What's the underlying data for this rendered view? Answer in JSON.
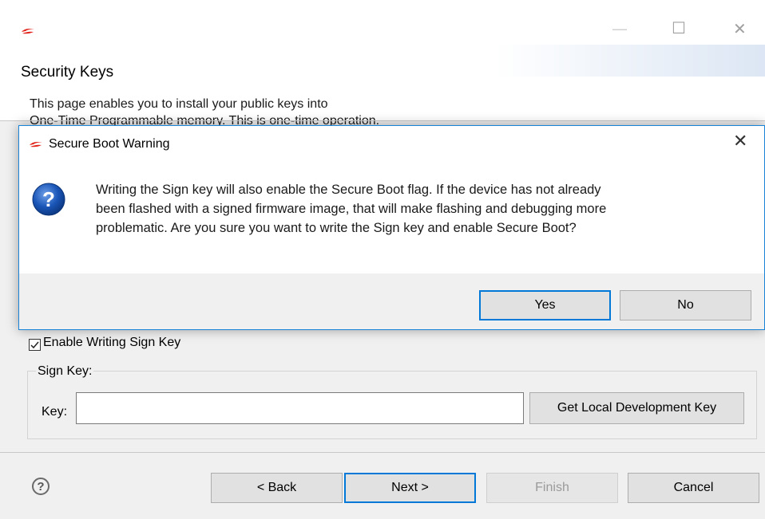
{
  "wizard": {
    "window_controls": {
      "minimize": "—",
      "maximize": "☐",
      "close": "✕"
    },
    "title": "Security Keys",
    "description_line1": "This page enables you to install your public keys into",
    "description_line2": "One-Time Programmable memory. This is one-time operation.",
    "enable_checkbox": {
      "label": "Enable Writing Sign Key",
      "checked": true
    },
    "sign_key_group": {
      "legend": "Sign Key:",
      "key_label": "Key:",
      "key_value": "",
      "get_key_button": "Get Local Development Key"
    },
    "buttons": {
      "back": "< Back",
      "next": "Next >",
      "finish": "Finish",
      "cancel": "Cancel"
    },
    "help_icon": "question-circle-icon"
  },
  "dialog": {
    "title": "Secure Boot Warning",
    "close": "✕",
    "icon": "question-icon",
    "message_line1": "Writing the Sign key will also enable the Secure Boot flag. If the device has not already",
    "message_line2": "been flashed with a signed firmware image, that will make flashing and debugging more",
    "message_line3": "problematic. Are you sure you want to write the Sign key and enable Secure Boot?",
    "yes": "Yes",
    "no": "No"
  },
  "colors": {
    "accent": "#0078d7",
    "logo_red": "#e2231a",
    "question_blue": "#1a56b8"
  }
}
